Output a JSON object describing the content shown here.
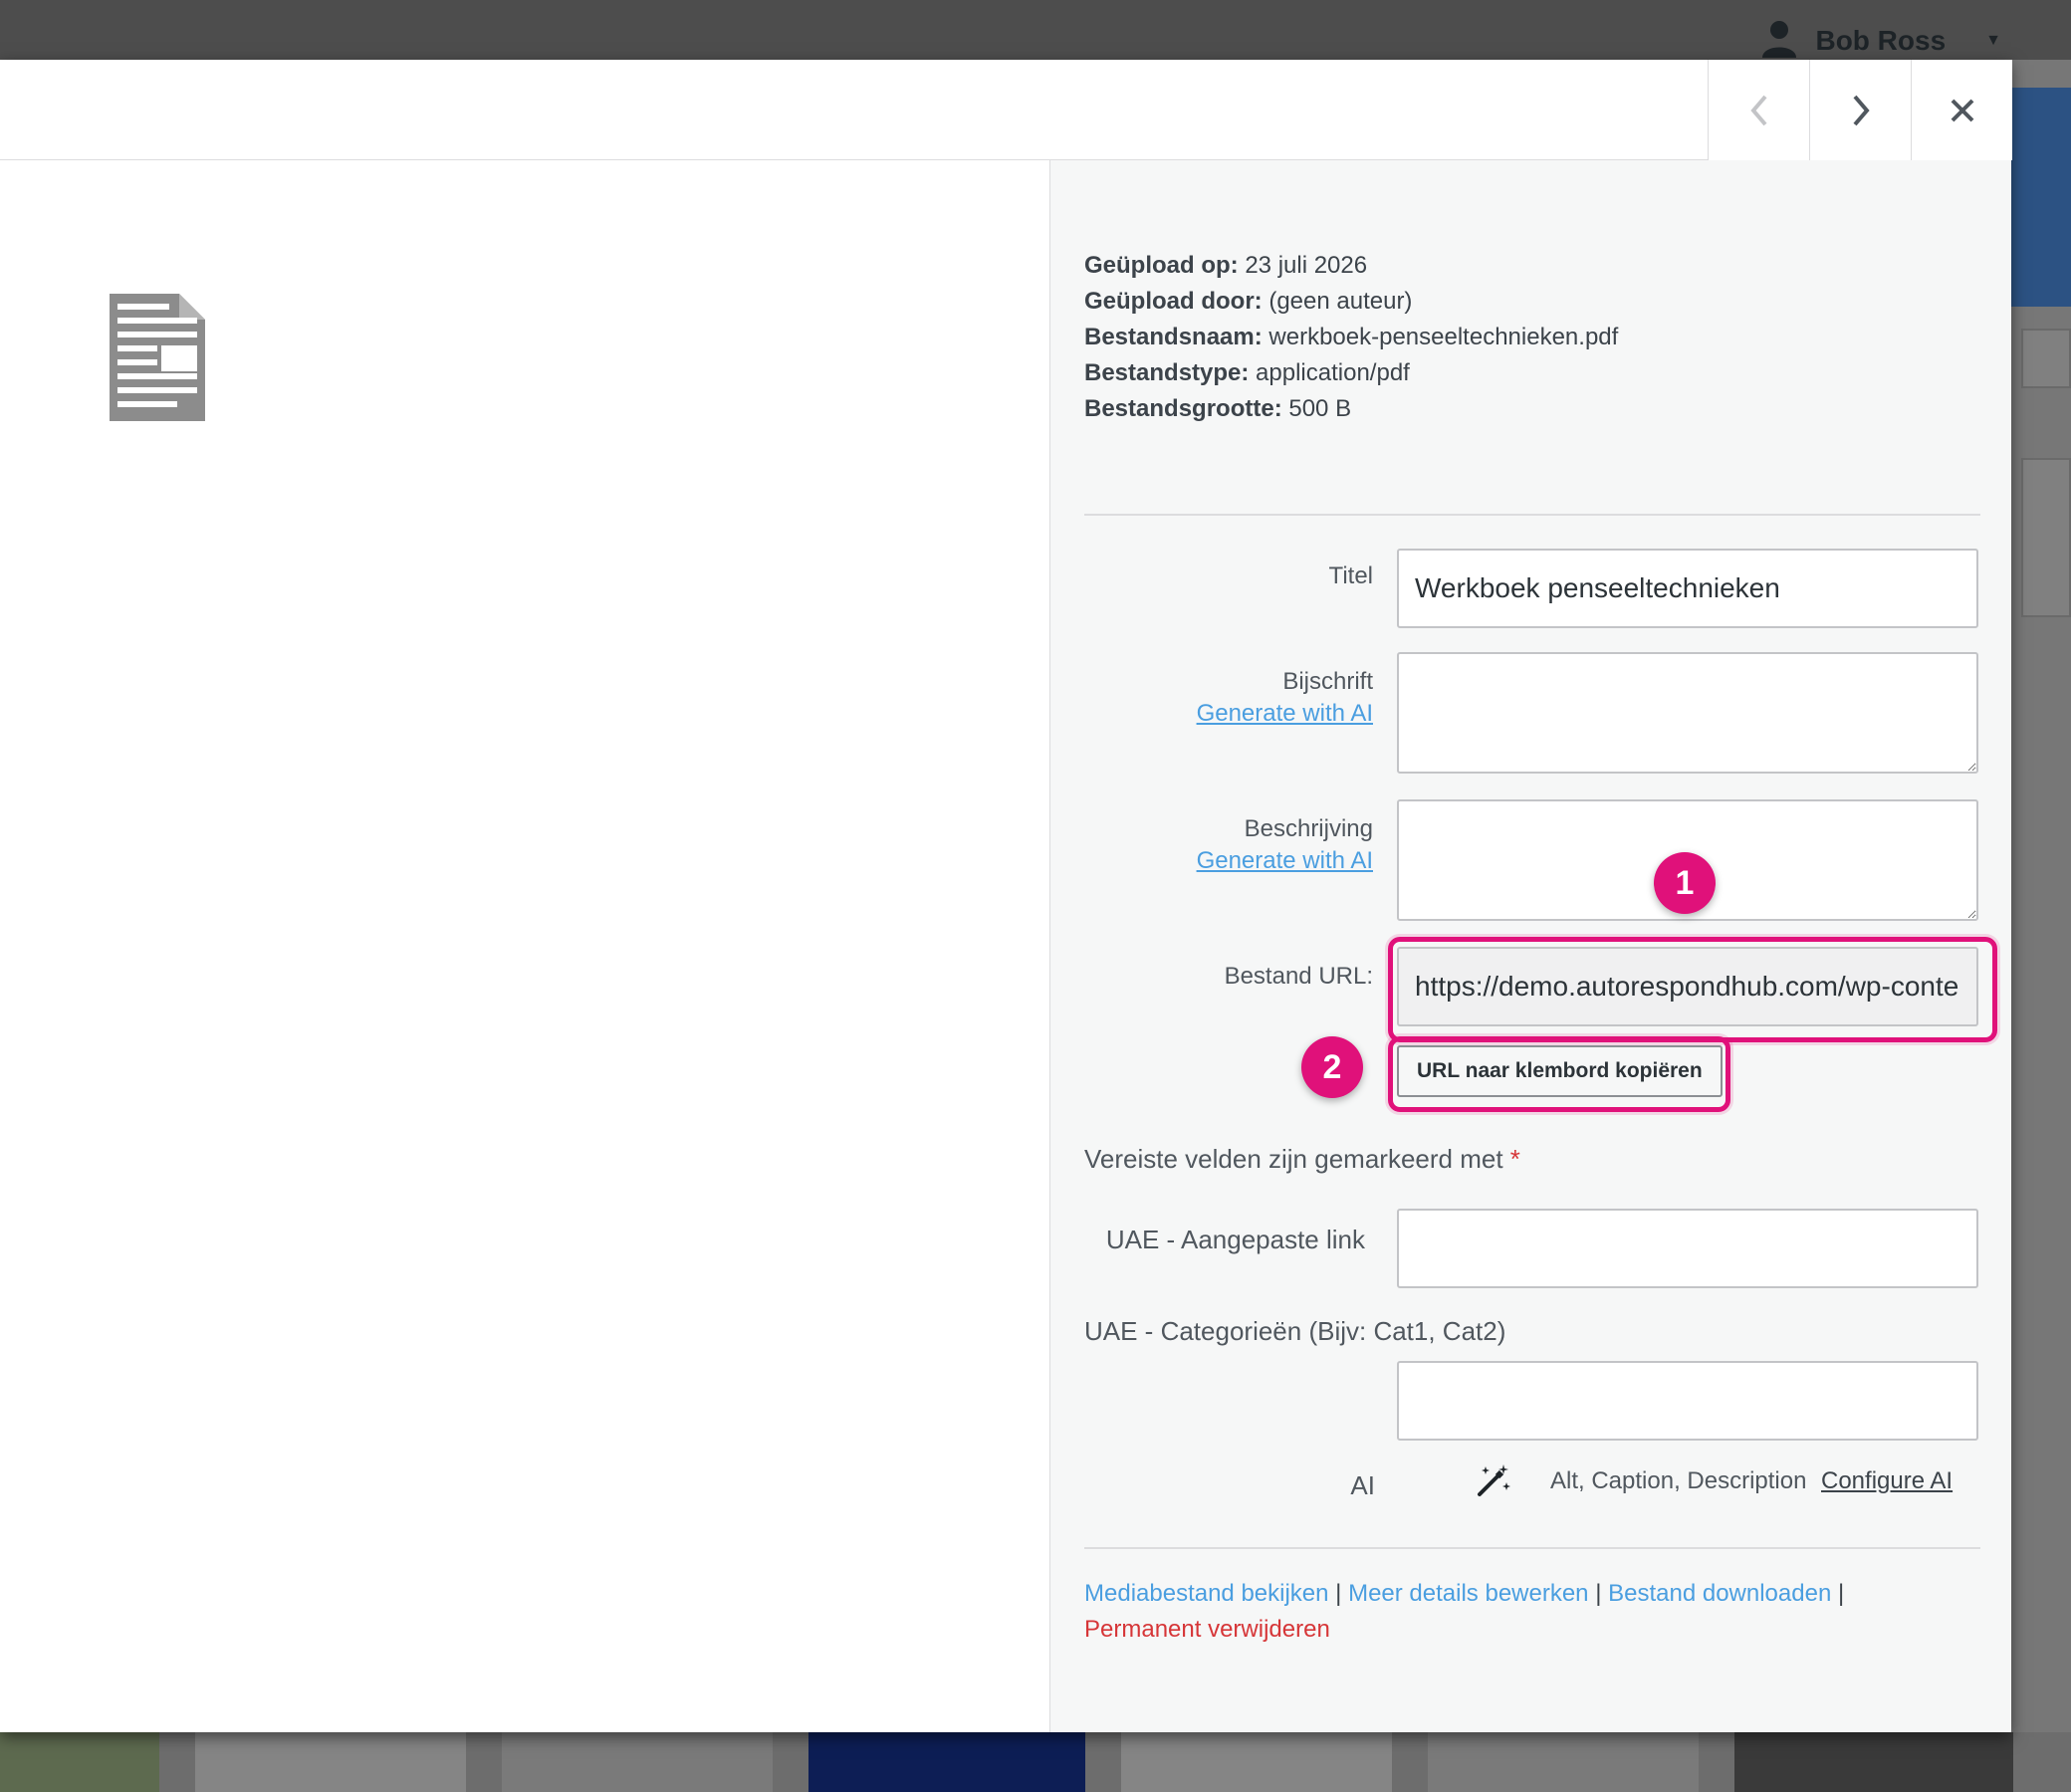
{
  "admin_bar": {
    "user_name": "Bob Ross"
  },
  "file_meta": [
    {
      "label": "Geüpload op:",
      "value": "23 juli 2026"
    },
    {
      "label": "Geüpload door:",
      "value": "(geen auteur)"
    },
    {
      "label": "Bestandsnaam:",
      "value": "werkboek-penseeltechnieken.pdf"
    },
    {
      "label": "Bestandstype:",
      "value": "application/pdf"
    },
    {
      "label": "Bestandsgrootte:",
      "value": "500 B"
    }
  ],
  "fields": {
    "title": {
      "label": "Titel",
      "value": "Werkboek penseeltechnieken"
    },
    "caption": {
      "label": "Bijschrift",
      "ai_link": "Generate with AI",
      "value": ""
    },
    "description": {
      "label": "Beschrijving",
      "ai_link": "Generate with AI",
      "value": ""
    },
    "file_url": {
      "label": "Bestand URL:",
      "value": "https://demo.autorespondhub.com/wp-content/uploads/werkboek-penseeltechnieken.pdf"
    },
    "copy_button": "URL naar klembord kopiëren"
  },
  "required_note": {
    "text": "Vereiste velden zijn gemarkeerd met",
    "star": "*"
  },
  "uae": {
    "custom_link_label": "UAE - Aangepaste link",
    "custom_link_value": "",
    "categories_label": "UAE - Categorieën (Bijv: Cat1, Cat2)",
    "categories_value": ""
  },
  "ai_row": {
    "label": "AI",
    "icon": "magic-wand-icon",
    "description": "Alt, Caption, Description",
    "configure": "Configure AI"
  },
  "actions": {
    "view": "Mediabestand bekijken",
    "edit": "Meer details bewerken",
    "download": "Bestand downloaden",
    "delete": "Permanent verwijderen",
    "separator": "|"
  },
  "annotations": {
    "badge_1": "1",
    "badge_2": "2",
    "highlight_color": "#e0117a"
  },
  "colors": {
    "link": "#4a9ee0",
    "danger": "#d63638",
    "panel_bg": "#f6f7f7"
  }
}
